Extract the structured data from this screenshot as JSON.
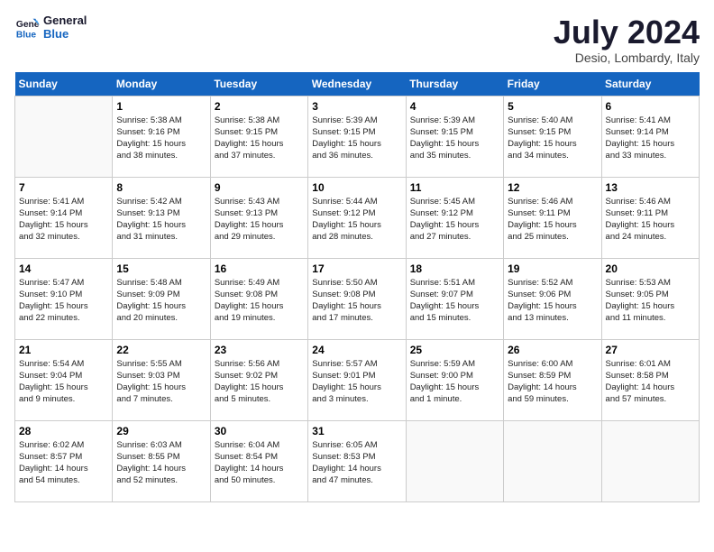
{
  "header": {
    "logo_line1": "General",
    "logo_line2": "Blue",
    "month_title": "July 2024",
    "location": "Desio, Lombardy, Italy"
  },
  "weekdays": [
    "Sunday",
    "Monday",
    "Tuesday",
    "Wednesday",
    "Thursday",
    "Friday",
    "Saturday"
  ],
  "weeks": [
    [
      {
        "day": "",
        "info": ""
      },
      {
        "day": "1",
        "info": "Sunrise: 5:38 AM\nSunset: 9:16 PM\nDaylight: 15 hours\nand 38 minutes."
      },
      {
        "day": "2",
        "info": "Sunrise: 5:38 AM\nSunset: 9:15 PM\nDaylight: 15 hours\nand 37 minutes."
      },
      {
        "day": "3",
        "info": "Sunrise: 5:39 AM\nSunset: 9:15 PM\nDaylight: 15 hours\nand 36 minutes."
      },
      {
        "day": "4",
        "info": "Sunrise: 5:39 AM\nSunset: 9:15 PM\nDaylight: 15 hours\nand 35 minutes."
      },
      {
        "day": "5",
        "info": "Sunrise: 5:40 AM\nSunset: 9:15 PM\nDaylight: 15 hours\nand 34 minutes."
      },
      {
        "day": "6",
        "info": "Sunrise: 5:41 AM\nSunset: 9:14 PM\nDaylight: 15 hours\nand 33 minutes."
      }
    ],
    [
      {
        "day": "7",
        "info": "Sunrise: 5:41 AM\nSunset: 9:14 PM\nDaylight: 15 hours\nand 32 minutes."
      },
      {
        "day": "8",
        "info": "Sunrise: 5:42 AM\nSunset: 9:13 PM\nDaylight: 15 hours\nand 31 minutes."
      },
      {
        "day": "9",
        "info": "Sunrise: 5:43 AM\nSunset: 9:13 PM\nDaylight: 15 hours\nand 29 minutes."
      },
      {
        "day": "10",
        "info": "Sunrise: 5:44 AM\nSunset: 9:12 PM\nDaylight: 15 hours\nand 28 minutes."
      },
      {
        "day": "11",
        "info": "Sunrise: 5:45 AM\nSunset: 9:12 PM\nDaylight: 15 hours\nand 27 minutes."
      },
      {
        "day": "12",
        "info": "Sunrise: 5:46 AM\nSunset: 9:11 PM\nDaylight: 15 hours\nand 25 minutes."
      },
      {
        "day": "13",
        "info": "Sunrise: 5:46 AM\nSunset: 9:11 PM\nDaylight: 15 hours\nand 24 minutes."
      }
    ],
    [
      {
        "day": "14",
        "info": "Sunrise: 5:47 AM\nSunset: 9:10 PM\nDaylight: 15 hours\nand 22 minutes."
      },
      {
        "day": "15",
        "info": "Sunrise: 5:48 AM\nSunset: 9:09 PM\nDaylight: 15 hours\nand 20 minutes."
      },
      {
        "day": "16",
        "info": "Sunrise: 5:49 AM\nSunset: 9:08 PM\nDaylight: 15 hours\nand 19 minutes."
      },
      {
        "day": "17",
        "info": "Sunrise: 5:50 AM\nSunset: 9:08 PM\nDaylight: 15 hours\nand 17 minutes."
      },
      {
        "day": "18",
        "info": "Sunrise: 5:51 AM\nSunset: 9:07 PM\nDaylight: 15 hours\nand 15 minutes."
      },
      {
        "day": "19",
        "info": "Sunrise: 5:52 AM\nSunset: 9:06 PM\nDaylight: 15 hours\nand 13 minutes."
      },
      {
        "day": "20",
        "info": "Sunrise: 5:53 AM\nSunset: 9:05 PM\nDaylight: 15 hours\nand 11 minutes."
      }
    ],
    [
      {
        "day": "21",
        "info": "Sunrise: 5:54 AM\nSunset: 9:04 PM\nDaylight: 15 hours\nand 9 minutes."
      },
      {
        "day": "22",
        "info": "Sunrise: 5:55 AM\nSunset: 9:03 PM\nDaylight: 15 hours\nand 7 minutes."
      },
      {
        "day": "23",
        "info": "Sunrise: 5:56 AM\nSunset: 9:02 PM\nDaylight: 15 hours\nand 5 minutes."
      },
      {
        "day": "24",
        "info": "Sunrise: 5:57 AM\nSunset: 9:01 PM\nDaylight: 15 hours\nand 3 minutes."
      },
      {
        "day": "25",
        "info": "Sunrise: 5:59 AM\nSunset: 9:00 PM\nDaylight: 15 hours\nand 1 minute."
      },
      {
        "day": "26",
        "info": "Sunrise: 6:00 AM\nSunset: 8:59 PM\nDaylight: 14 hours\nand 59 minutes."
      },
      {
        "day": "27",
        "info": "Sunrise: 6:01 AM\nSunset: 8:58 PM\nDaylight: 14 hours\nand 57 minutes."
      }
    ],
    [
      {
        "day": "28",
        "info": "Sunrise: 6:02 AM\nSunset: 8:57 PM\nDaylight: 14 hours\nand 54 minutes."
      },
      {
        "day": "29",
        "info": "Sunrise: 6:03 AM\nSunset: 8:55 PM\nDaylight: 14 hours\nand 52 minutes."
      },
      {
        "day": "30",
        "info": "Sunrise: 6:04 AM\nSunset: 8:54 PM\nDaylight: 14 hours\nand 50 minutes."
      },
      {
        "day": "31",
        "info": "Sunrise: 6:05 AM\nSunset: 8:53 PM\nDaylight: 14 hours\nand 47 minutes."
      },
      {
        "day": "",
        "info": ""
      },
      {
        "day": "",
        "info": ""
      },
      {
        "day": "",
        "info": ""
      }
    ]
  ]
}
